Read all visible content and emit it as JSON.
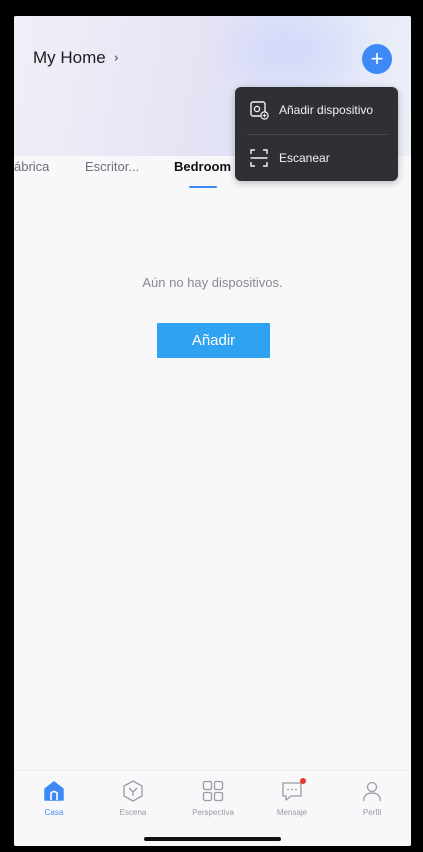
{
  "header": {
    "home_name": "My Home",
    "chevron": "›",
    "add_icon": "plus-icon",
    "plus_symbol": "+",
    "accent_color": "#3d8af7"
  },
  "rooms": {
    "tabs": [
      {
        "label": "ábrica",
        "active": false
      },
      {
        "label": "Escritor...",
        "active": false
      },
      {
        "label": "Bedroom",
        "active": true
      }
    ]
  },
  "menu": {
    "items": [
      {
        "label": "Añadir dispositivo",
        "icon": "add-device-icon"
      },
      {
        "label": "Escanear",
        "icon": "scan-icon"
      }
    ]
  },
  "main": {
    "empty_message": "Aún no hay dispositivos.",
    "add_button": "Añadir",
    "add_button_color": "#2fa3f2"
  },
  "tabbar": {
    "items": [
      {
        "label": "Casa",
        "icon": "home-icon",
        "active": true
      },
      {
        "label": "Escena",
        "icon": "scene-icon",
        "active": false
      },
      {
        "label": "Perspectiva",
        "icon": "grid-icon",
        "active": false
      },
      {
        "label": "Mensaje",
        "icon": "message-icon",
        "active": false,
        "badge": true
      },
      {
        "label": "Perfil",
        "icon": "profile-icon",
        "active": false
      }
    ]
  }
}
